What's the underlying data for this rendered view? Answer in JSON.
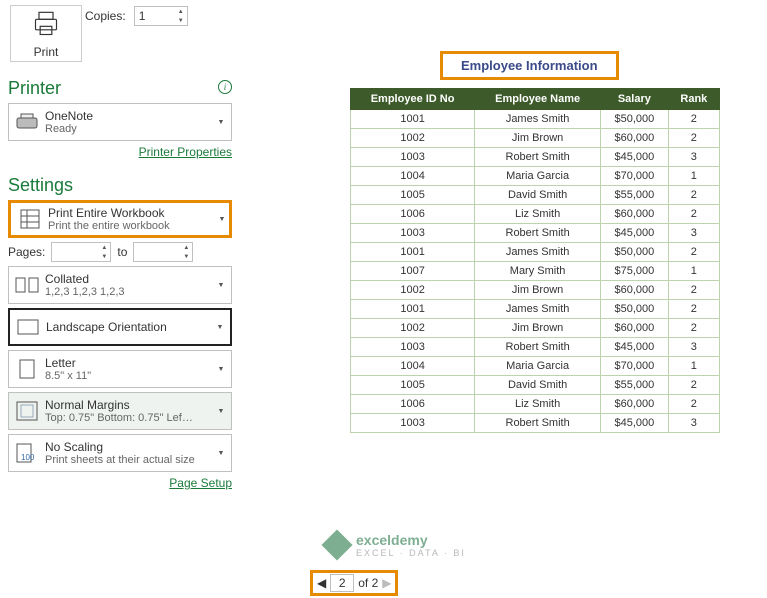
{
  "print": {
    "label": "Print",
    "copies_label": "Copies:",
    "copies_value": "1"
  },
  "printer": {
    "heading": "Printer",
    "name": "OneNote",
    "status": "Ready",
    "properties_link": "Printer Properties"
  },
  "settings": {
    "heading": "Settings",
    "scope": {
      "line1": "Print Entire Workbook",
      "line2": "Print the entire workbook"
    },
    "pages_label": "Pages:",
    "pages_to": "to",
    "collation": {
      "line1": "Collated",
      "line2": "1,2,3   1,2,3   1,2,3"
    },
    "orientation": {
      "line1": "Landscape Orientation",
      "line2": ""
    },
    "paper": {
      "line1": "Letter",
      "line2": "8.5\" x 11\""
    },
    "margins": {
      "line1": "Normal Margins",
      "line2": "Top: 0.75\" Bottom: 0.75\" Lef…"
    },
    "scaling": {
      "line1": "No Scaling",
      "line2": "Print sheets at their actual size"
    },
    "page_setup_link": "Page Setup"
  },
  "preview": {
    "title": "Employee Information",
    "headers": [
      "Employee ID No",
      "Employee Name",
      "Salary",
      "Rank"
    ],
    "rows": [
      [
        "1001",
        "James Smith",
        "$50,000",
        "2"
      ],
      [
        "1002",
        "Jim Brown",
        "$60,000",
        "2"
      ],
      [
        "1003",
        "Robert Smith",
        "$45,000",
        "3"
      ],
      [
        "1004",
        "Maria Garcia",
        "$70,000",
        "1"
      ],
      [
        "1005",
        "David Smith",
        "$55,000",
        "2"
      ],
      [
        "1006",
        "Liz Smith",
        "$60,000",
        "2"
      ],
      [
        "1003",
        "Robert Smith",
        "$45,000",
        "3"
      ],
      [
        "1001",
        "James Smith",
        "$50,000",
        "2"
      ],
      [
        "1007",
        "Mary Smith",
        "$75,000",
        "1"
      ],
      [
        "1002",
        "Jim Brown",
        "$60,000",
        "2"
      ],
      [
        "1001",
        "James Smith",
        "$50,000",
        "2"
      ],
      [
        "1002",
        "Jim Brown",
        "$60,000",
        "2"
      ],
      [
        "1003",
        "Robert Smith",
        "$45,000",
        "3"
      ],
      [
        "1004",
        "Maria Garcia",
        "$70,000",
        "1"
      ],
      [
        "1005",
        "David Smith",
        "$55,000",
        "2"
      ],
      [
        "1006",
        "Liz Smith",
        "$60,000",
        "2"
      ],
      [
        "1003",
        "Robert Smith",
        "$45,000",
        "3"
      ]
    ],
    "watermark": {
      "name": "exceldemy",
      "tagline": "EXCEL · DATA · BI"
    },
    "pager": {
      "current": "2",
      "total_text": "of 2"
    }
  }
}
